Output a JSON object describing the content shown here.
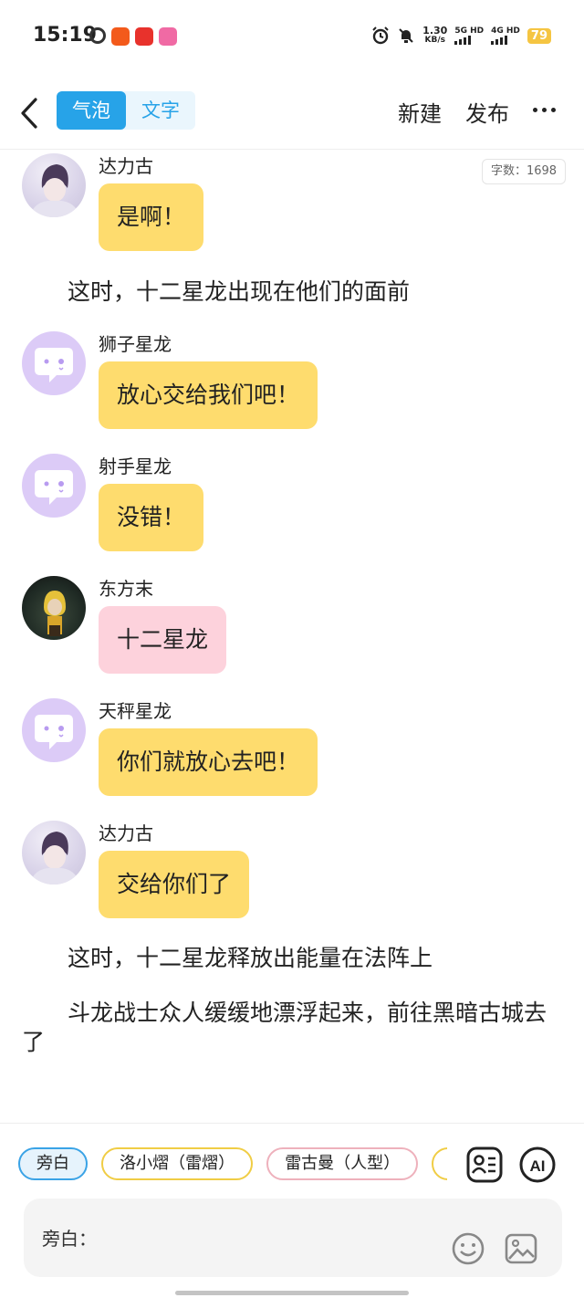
{
  "status": {
    "time": "15:19",
    "speed_value": "1.30",
    "speed_unit": "KB/s",
    "sim1": "5G HD",
    "sim2": "4G HD",
    "battery": "79"
  },
  "header": {
    "tab_bubble": "气泡",
    "tab_text": "文字",
    "new_label": "新建",
    "publish_label": "发布"
  },
  "word_count": "字数：1698",
  "messages": [
    {
      "name": "达力古",
      "text": "是啊！",
      "bubble_color": "#fedc6e",
      "avatar": "photo-avatar"
    },
    {
      "name": "狮子星龙",
      "text": "放心交给我们吧！",
      "bubble_color": "#fedc6e",
      "avatar": "chat-bubble-avatar"
    },
    {
      "name": "射手星龙",
      "text": "没错！",
      "bubble_color": "#fedc6e",
      "avatar": "chat-bubble-avatar"
    },
    {
      "name": "东方末",
      "text": "十二星龙",
      "bubble_color": "#fdd2dc",
      "avatar": "photo-avatar"
    },
    {
      "name": "天秤星龙",
      "text": "你们就放心去吧！",
      "bubble_color": "#fedc6e",
      "avatar": "chat-bubble-avatar"
    },
    {
      "name": "达力古",
      "text": "交给你们了",
      "bubble_color": "#fedc6e",
      "avatar": "photo-avatar"
    }
  ],
  "narrations": [
    "这时，十二星龙出现在他们的面前",
    "这时，十二星龙释放出能量在法阵上",
    "斗龙战士众人缓缓地漂浮起来，前往黑暗古城去了"
  ],
  "characters": [
    {
      "label": "旁白",
      "selected": true
    },
    {
      "label": "洛小熠（雷熠）",
      "selected": false
    },
    {
      "label": "雷古曼（人型）",
      "selected": false
    }
  ],
  "input": {
    "label": "旁白："
  },
  "colors": {
    "accent": "#27a3e8",
    "yellow_bubble": "#fedc6e",
    "pink_bubble": "#fdd2dc"
  }
}
